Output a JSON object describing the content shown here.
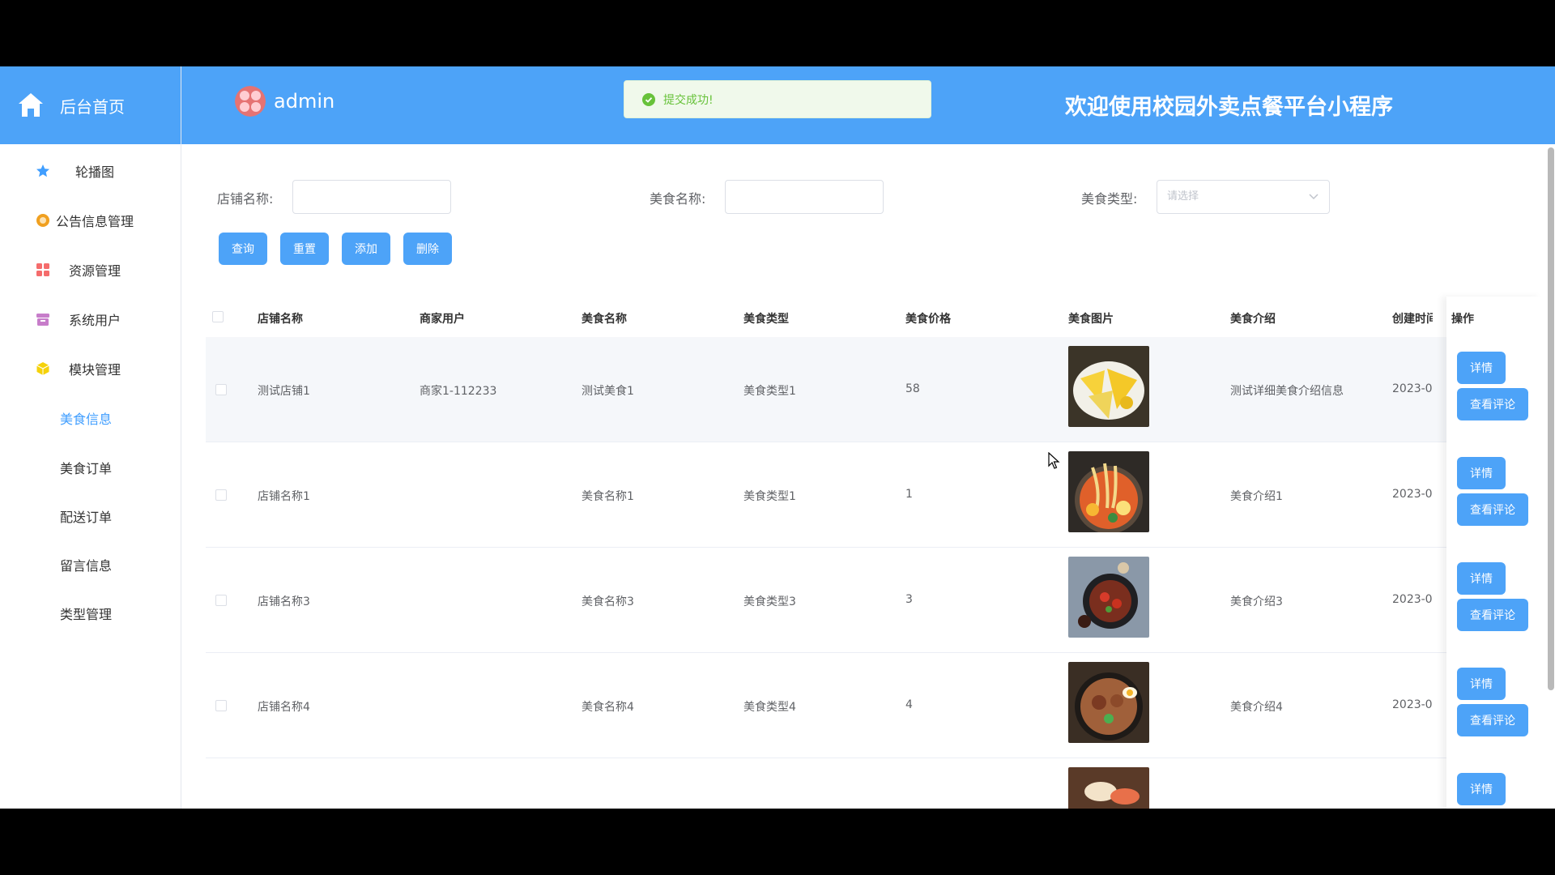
{
  "header": {
    "brand_label": "后台首页",
    "username": "admin",
    "toast": "提交成功!",
    "welcome": "欢迎使用校园外卖点餐平台小程序"
  },
  "sidebar": {
    "items": [
      {
        "label": "轮播图",
        "icon": "star-icon",
        "color": "#409eff"
      },
      {
        "label": "公告信息管理",
        "icon": "badge-icon",
        "color": "#f0a020"
      },
      {
        "label": "资源管理",
        "icon": "grid-icon",
        "color": "#f56c6c"
      },
      {
        "label": "系统用户",
        "icon": "archive-icon",
        "color": "#c77dca"
      },
      {
        "label": "模块管理",
        "icon": "cube-icon",
        "color": "#f5d20a"
      }
    ],
    "subitems": [
      {
        "label": "美食信息",
        "active": true
      },
      {
        "label": "美食订单"
      },
      {
        "label": "配送订单"
      },
      {
        "label": "留言信息"
      },
      {
        "label": "类型管理"
      }
    ]
  },
  "search": {
    "shop_label": "店铺名称:",
    "food_label": "美食名称:",
    "type_label": "美食类型:",
    "type_placeholder": "请选择"
  },
  "buttons": {
    "query": "查询",
    "reset": "重置",
    "add": "添加",
    "delete": "删除"
  },
  "table": {
    "headers": [
      "店铺名称",
      "商家用户",
      "美食名称",
      "美食类型",
      "美食价格",
      "美食图片",
      "美食介绍",
      "创建时间",
      "操作"
    ],
    "rows": [
      {
        "shop": "测试店铺1",
        "merchant": "商家1-112233",
        "food": "测试美食1",
        "type": "美食类型1",
        "price": "58",
        "intro": "测试详细美食介绍信息",
        "created": "2023-0"
      },
      {
        "shop": "店铺名称1",
        "merchant": "",
        "food": "美食名称1",
        "type": "美食类型1",
        "price": "1",
        "intro": "美食介绍1",
        "created": "2023-0"
      },
      {
        "shop": "店铺名称3",
        "merchant": "",
        "food": "美食名称3",
        "type": "美食类型3",
        "price": "3",
        "intro": "美食介绍3",
        "created": "2023-0"
      },
      {
        "shop": "店铺名称4",
        "merchant": "",
        "food": "美食名称4",
        "type": "美食类型4",
        "price": "4",
        "intro": "美食介绍4",
        "created": "2023-0"
      }
    ],
    "detail_label": "详情",
    "review_label": "查看评论"
  },
  "colors": {
    "primary": "#4da3f8",
    "success": "#67c23a"
  }
}
